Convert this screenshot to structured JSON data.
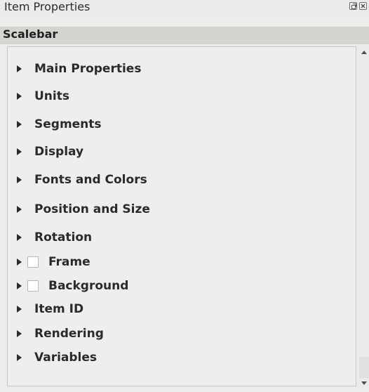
{
  "window": {
    "title": "Item Properties"
  },
  "header": {
    "label": "Scalebar"
  },
  "sections": [
    {
      "label": "Main Properties",
      "checkbox": false
    },
    {
      "label": "Units",
      "checkbox": false
    },
    {
      "label": "Segments",
      "checkbox": false
    },
    {
      "label": "Display",
      "checkbox": false
    },
    {
      "label": "Fonts and Colors",
      "checkbox": false
    },
    {
      "label": "Position and Size",
      "checkbox": false
    },
    {
      "label": "Rotation",
      "checkbox": false
    },
    {
      "label": "Frame",
      "checkbox": true,
      "checked": false
    },
    {
      "label": "Background",
      "checkbox": true,
      "checked": false
    },
    {
      "label": "Item ID",
      "checkbox": false
    },
    {
      "label": "Rendering",
      "checkbox": false
    },
    {
      "label": "Variables",
      "checkbox": false
    }
  ],
  "icons": {
    "collapse": "triangle-right-icon",
    "float": "float-window-icon",
    "close": "close-icon"
  }
}
